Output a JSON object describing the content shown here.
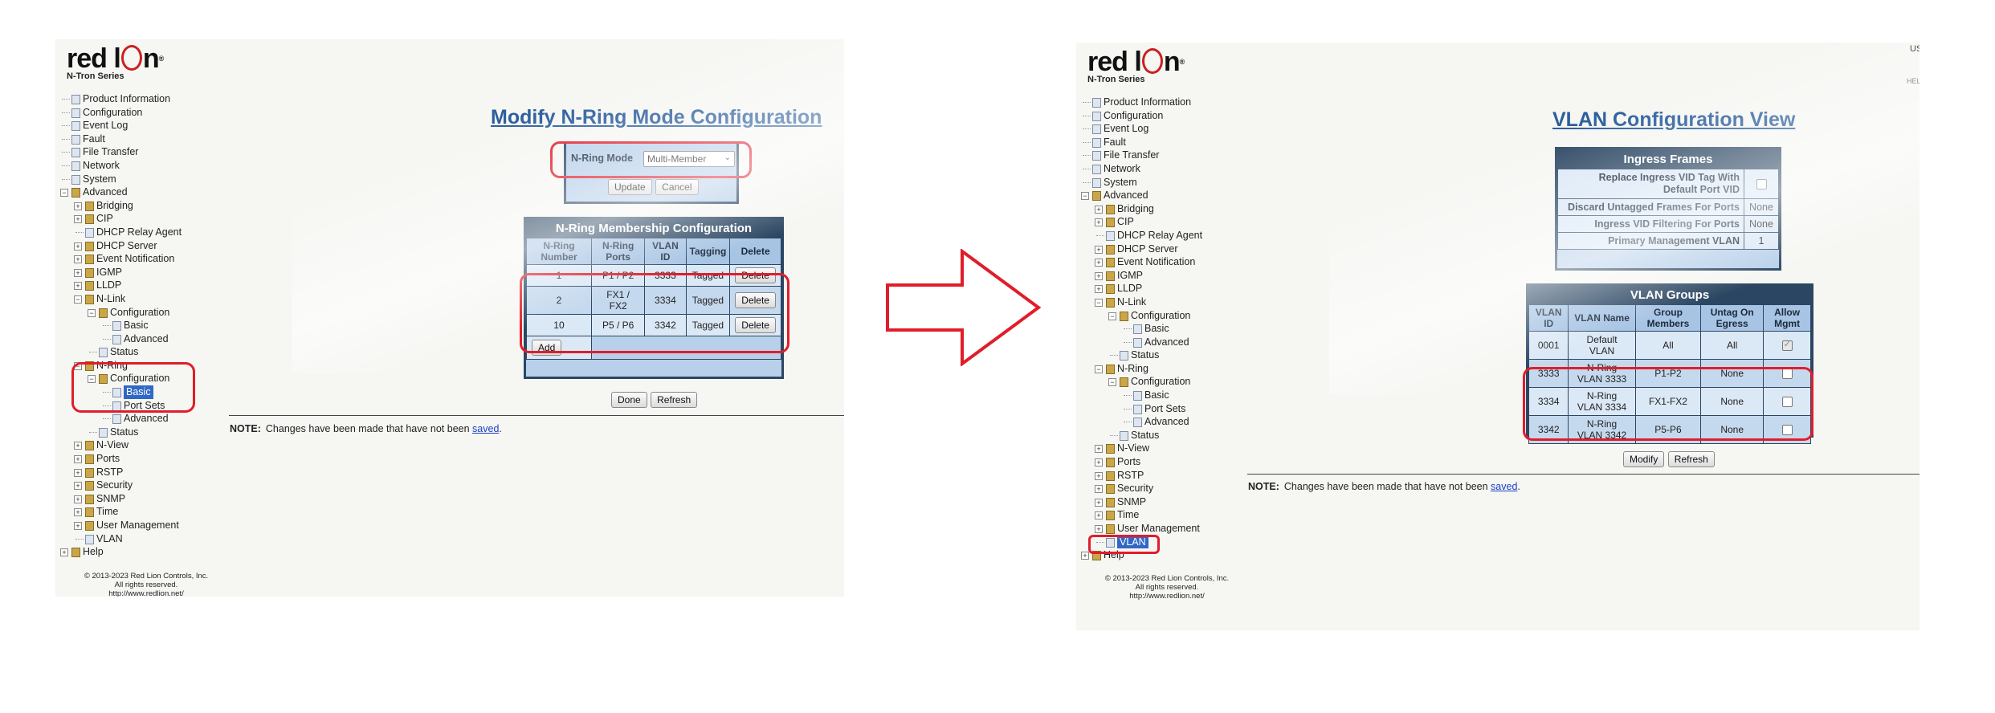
{
  "left": {
    "logo": {
      "brand": "red lion",
      "series": "N-Tron Series"
    },
    "tree": [
      {
        "label": "Product Information",
        "depth": 0,
        "type": "doc"
      },
      {
        "label": "Configuration",
        "depth": 0,
        "type": "doc"
      },
      {
        "label": "Event Log",
        "depth": 0,
        "type": "doc"
      },
      {
        "label": "Fault",
        "depth": 0,
        "type": "doc"
      },
      {
        "label": "File Transfer",
        "depth": 0,
        "type": "doc"
      },
      {
        "label": "Network",
        "depth": 0,
        "type": "doc"
      },
      {
        "label": "System",
        "depth": 0,
        "type": "doc"
      },
      {
        "label": "Advanced",
        "depth": 0,
        "type": "folder",
        "toggle": "-"
      },
      {
        "label": "Bridging",
        "depth": 1,
        "type": "folder",
        "toggle": "+"
      },
      {
        "label": "CIP",
        "depth": 1,
        "type": "folder",
        "toggle": "+"
      },
      {
        "label": "DHCP Relay Agent",
        "depth": 1,
        "type": "doc"
      },
      {
        "label": "DHCP Server",
        "depth": 1,
        "type": "folder",
        "toggle": "+"
      },
      {
        "label": "Event Notification",
        "depth": 1,
        "type": "folder",
        "toggle": "+"
      },
      {
        "label": "IGMP",
        "depth": 1,
        "type": "folder",
        "toggle": "+"
      },
      {
        "label": "LLDP",
        "depth": 1,
        "type": "folder",
        "toggle": "+"
      },
      {
        "label": "N-Link",
        "depth": 1,
        "type": "folder",
        "toggle": "-"
      },
      {
        "label": "Configuration",
        "depth": 2,
        "type": "folder",
        "toggle": "-"
      },
      {
        "label": "Basic",
        "depth": 3,
        "type": "doc"
      },
      {
        "label": "Advanced",
        "depth": 3,
        "type": "doc"
      },
      {
        "label": "Status",
        "depth": 2,
        "type": "doc"
      },
      {
        "label": "N-Ring",
        "depth": 1,
        "type": "folder",
        "toggle": "-"
      },
      {
        "label": "Configuration",
        "depth": 2,
        "type": "folder",
        "toggle": "-"
      },
      {
        "label": "Basic",
        "depth": 3,
        "type": "doc",
        "selected": true
      },
      {
        "label": "Port Sets",
        "depth": 3,
        "type": "doc"
      },
      {
        "label": "Advanced",
        "depth": 3,
        "type": "doc"
      },
      {
        "label": "Status",
        "depth": 2,
        "type": "doc"
      },
      {
        "label": "N-View",
        "depth": 1,
        "type": "folder",
        "toggle": "+"
      },
      {
        "label": "Ports",
        "depth": 1,
        "type": "folder",
        "toggle": "+"
      },
      {
        "label": "RSTP",
        "depth": 1,
        "type": "folder",
        "toggle": "+"
      },
      {
        "label": "Security",
        "depth": 1,
        "type": "folder",
        "toggle": "+"
      },
      {
        "label": "SNMP",
        "depth": 1,
        "type": "folder",
        "toggle": "+"
      },
      {
        "label": "Time",
        "depth": 1,
        "type": "folder",
        "toggle": "+"
      },
      {
        "label": "User Management",
        "depth": 1,
        "type": "folder",
        "toggle": "+"
      },
      {
        "label": "VLAN",
        "depth": 1,
        "type": "doc"
      },
      {
        "label": "Help",
        "depth": 0,
        "type": "folder",
        "toggle": "+"
      }
    ],
    "copyright": [
      "© 2013-2023 Red Lion Controls, Inc.",
      "All rights reserved.",
      "http://www.redlion.net/"
    ],
    "title": "Modify N-Ring Mode Configuration",
    "mode": {
      "label": "N-Ring Mode",
      "selected": "Multi-Member",
      "update": "Update",
      "cancel": "Cancel"
    },
    "membership": {
      "header": "N-Ring Membership Configuration",
      "columns": [
        "N-Ring Number",
        "N-Ring Ports",
        "VLAN ID",
        "Tagging",
        "Delete"
      ],
      "rows": [
        {
          "number": "1",
          "ports": "P1 / P2",
          "vlan": "3333",
          "tagging": "Tagged",
          "del": "Delete"
        },
        {
          "number": "2",
          "ports": "FX1 / FX2",
          "vlan": "3334",
          "tagging": "Tagged",
          "del": "Delete"
        },
        {
          "number": "10",
          "ports": "P5 / P6",
          "vlan": "3342",
          "tagging": "Tagged",
          "del": "Delete"
        }
      ],
      "add": "Add"
    },
    "done": "Done",
    "refresh": "Refresh",
    "note": {
      "label": "NOTE:",
      "text": "Changes have been made that have not been",
      "link": "saved",
      "end": "."
    }
  },
  "right": {
    "logo": {
      "brand": "red lion",
      "series": "N-Tron Series"
    },
    "corner": {
      "top": "US",
      "bottom": "HEL"
    },
    "tree": [
      {
        "label": "Product Information",
        "depth": 0,
        "type": "doc"
      },
      {
        "label": "Configuration",
        "depth": 0,
        "type": "doc"
      },
      {
        "label": "Event Log",
        "depth": 0,
        "type": "doc"
      },
      {
        "label": "Fault",
        "depth": 0,
        "type": "doc"
      },
      {
        "label": "File Transfer",
        "depth": 0,
        "type": "doc"
      },
      {
        "label": "Network",
        "depth": 0,
        "type": "doc"
      },
      {
        "label": "System",
        "depth": 0,
        "type": "doc"
      },
      {
        "label": "Advanced",
        "depth": 0,
        "type": "folder",
        "toggle": "-"
      },
      {
        "label": "Bridging",
        "depth": 1,
        "type": "folder",
        "toggle": "+"
      },
      {
        "label": "CIP",
        "depth": 1,
        "type": "folder",
        "toggle": "+"
      },
      {
        "label": "DHCP Relay Agent",
        "depth": 1,
        "type": "doc"
      },
      {
        "label": "DHCP Server",
        "depth": 1,
        "type": "folder",
        "toggle": "+"
      },
      {
        "label": "Event Notification",
        "depth": 1,
        "type": "folder",
        "toggle": "+"
      },
      {
        "label": "IGMP",
        "depth": 1,
        "type": "folder",
        "toggle": "+"
      },
      {
        "label": "LLDP",
        "depth": 1,
        "type": "folder",
        "toggle": "+"
      },
      {
        "label": "N-Link",
        "depth": 1,
        "type": "folder",
        "toggle": "-"
      },
      {
        "label": "Configuration",
        "depth": 2,
        "type": "folder",
        "toggle": "-"
      },
      {
        "label": "Basic",
        "depth": 3,
        "type": "doc"
      },
      {
        "label": "Advanced",
        "depth": 3,
        "type": "doc"
      },
      {
        "label": "Status",
        "depth": 2,
        "type": "doc"
      },
      {
        "label": "N-Ring",
        "depth": 1,
        "type": "folder",
        "toggle": "-"
      },
      {
        "label": "Configuration",
        "depth": 2,
        "type": "folder",
        "toggle": "-"
      },
      {
        "label": "Basic",
        "depth": 3,
        "type": "doc"
      },
      {
        "label": "Port Sets",
        "depth": 3,
        "type": "doc"
      },
      {
        "label": "Advanced",
        "depth": 3,
        "type": "doc"
      },
      {
        "label": "Status",
        "depth": 2,
        "type": "doc"
      },
      {
        "label": "N-View",
        "depth": 1,
        "type": "folder",
        "toggle": "+"
      },
      {
        "label": "Ports",
        "depth": 1,
        "type": "folder",
        "toggle": "+"
      },
      {
        "label": "RSTP",
        "depth": 1,
        "type": "folder",
        "toggle": "+"
      },
      {
        "label": "Security",
        "depth": 1,
        "type": "folder",
        "toggle": "+"
      },
      {
        "label": "SNMP",
        "depth": 1,
        "type": "folder",
        "toggle": "+"
      },
      {
        "label": "Time",
        "depth": 1,
        "type": "folder",
        "toggle": "+"
      },
      {
        "label": "User Management",
        "depth": 1,
        "type": "folder",
        "toggle": "+"
      },
      {
        "label": "VLAN",
        "depth": 1,
        "type": "doc",
        "selected": true
      },
      {
        "label": "Help",
        "depth": 0,
        "type": "folder",
        "toggle": "+"
      }
    ],
    "copyright": [
      "© 2013-2023 Red Lion Controls, Inc.",
      "All rights reserved.",
      "http://www.redlion.net/"
    ],
    "title": "VLAN Configuration View",
    "ingress": {
      "header": "Ingress Frames",
      "rows": [
        {
          "label": "Replace Ingress VID Tag With Default Port VID",
          "value": "",
          "checkbox": true
        },
        {
          "label": "Discard Untagged Frames For Ports",
          "value": "None"
        },
        {
          "label": "Ingress VID Filtering For Ports",
          "value": "None"
        },
        {
          "label": "Primary Management VLAN",
          "value": "1"
        }
      ]
    },
    "groups": {
      "header": "VLAN Groups",
      "columns": [
        "VLAN ID",
        "VLAN Name",
        "Group Members",
        "Untag On Egress",
        "Allow Mgmt"
      ],
      "rows": [
        {
          "id": "0001",
          "name": "Default VLAN",
          "members": "All",
          "untag": "All",
          "mgmt": true
        },
        {
          "id": "3333",
          "name": "N-Ring VLAN 3333",
          "members": "P1-P2",
          "untag": "None",
          "mgmt": false
        },
        {
          "id": "3334",
          "name": "N-Ring VLAN 3334",
          "members": "FX1-FX2",
          "untag": "None",
          "mgmt": false
        },
        {
          "id": "3342",
          "name": "N-Ring VLAN 3342",
          "members": "P5-P6",
          "untag": "None",
          "mgmt": false
        }
      ]
    },
    "modify": "Modify",
    "refresh": "Refresh",
    "note": {
      "label": "NOTE:",
      "text": "Changes have been made that have not been",
      "link": "saved",
      "end": "."
    }
  },
  "colors": {
    "annotation": "#e11d2a",
    "dialog_border": "#2b4662",
    "title": "#2d5f9e"
  }
}
